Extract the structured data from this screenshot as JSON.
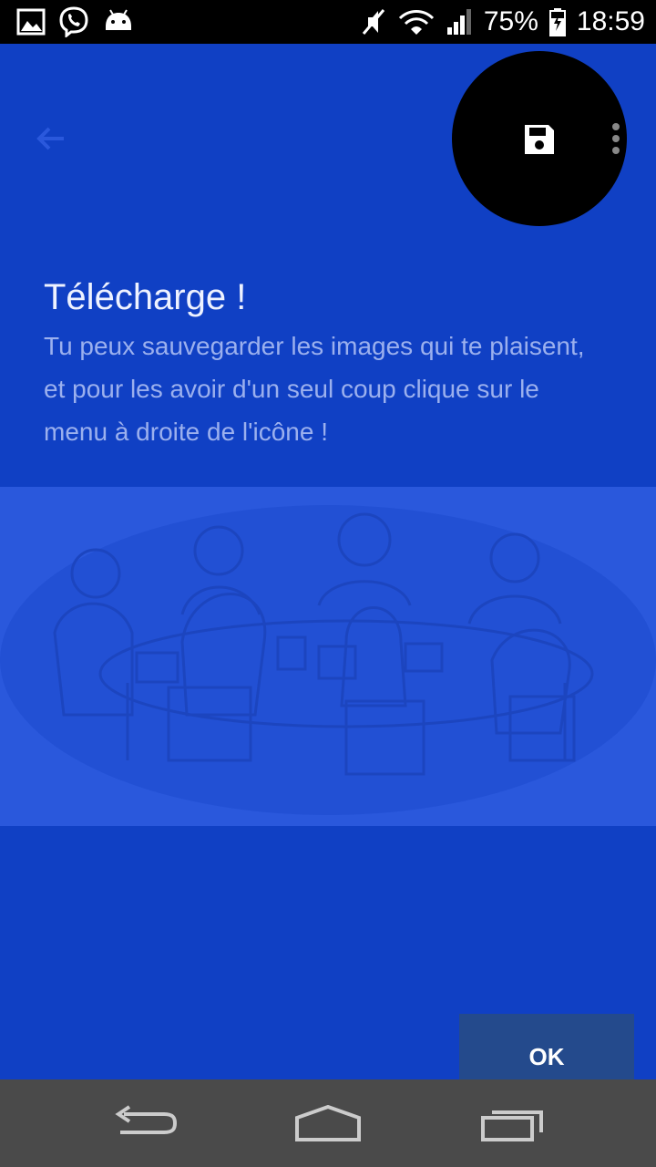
{
  "status_bar": {
    "left_icons": [
      "gallery-icon",
      "viber-icon",
      "android-icon"
    ],
    "right_icons": [
      "mute-icon",
      "wifi-icon",
      "signal-icon",
      "battery-charging-icon"
    ],
    "battery": "75%",
    "time": "18:59"
  },
  "toolbar": {
    "back_icon": "arrow-left-icon",
    "action_icons": [
      "save-icon",
      "more-vert-icon"
    ]
  },
  "tutorial": {
    "title": "Télécharge !",
    "body": "Tu peux sauvegarder les images qui te plaisent, et pour les avoir d'un seul coup clique sur le menu à droite de l'icône !",
    "ok_label": "OK"
  },
  "nav_bar": {
    "icons": [
      "back-icon",
      "home-icon",
      "recents-icon"
    ]
  },
  "colors": {
    "overlay": "#1040c4",
    "illustration_bg": "#2a58dc",
    "ok_button": "#244a8c",
    "nav_bar": "#4a4a4a"
  }
}
